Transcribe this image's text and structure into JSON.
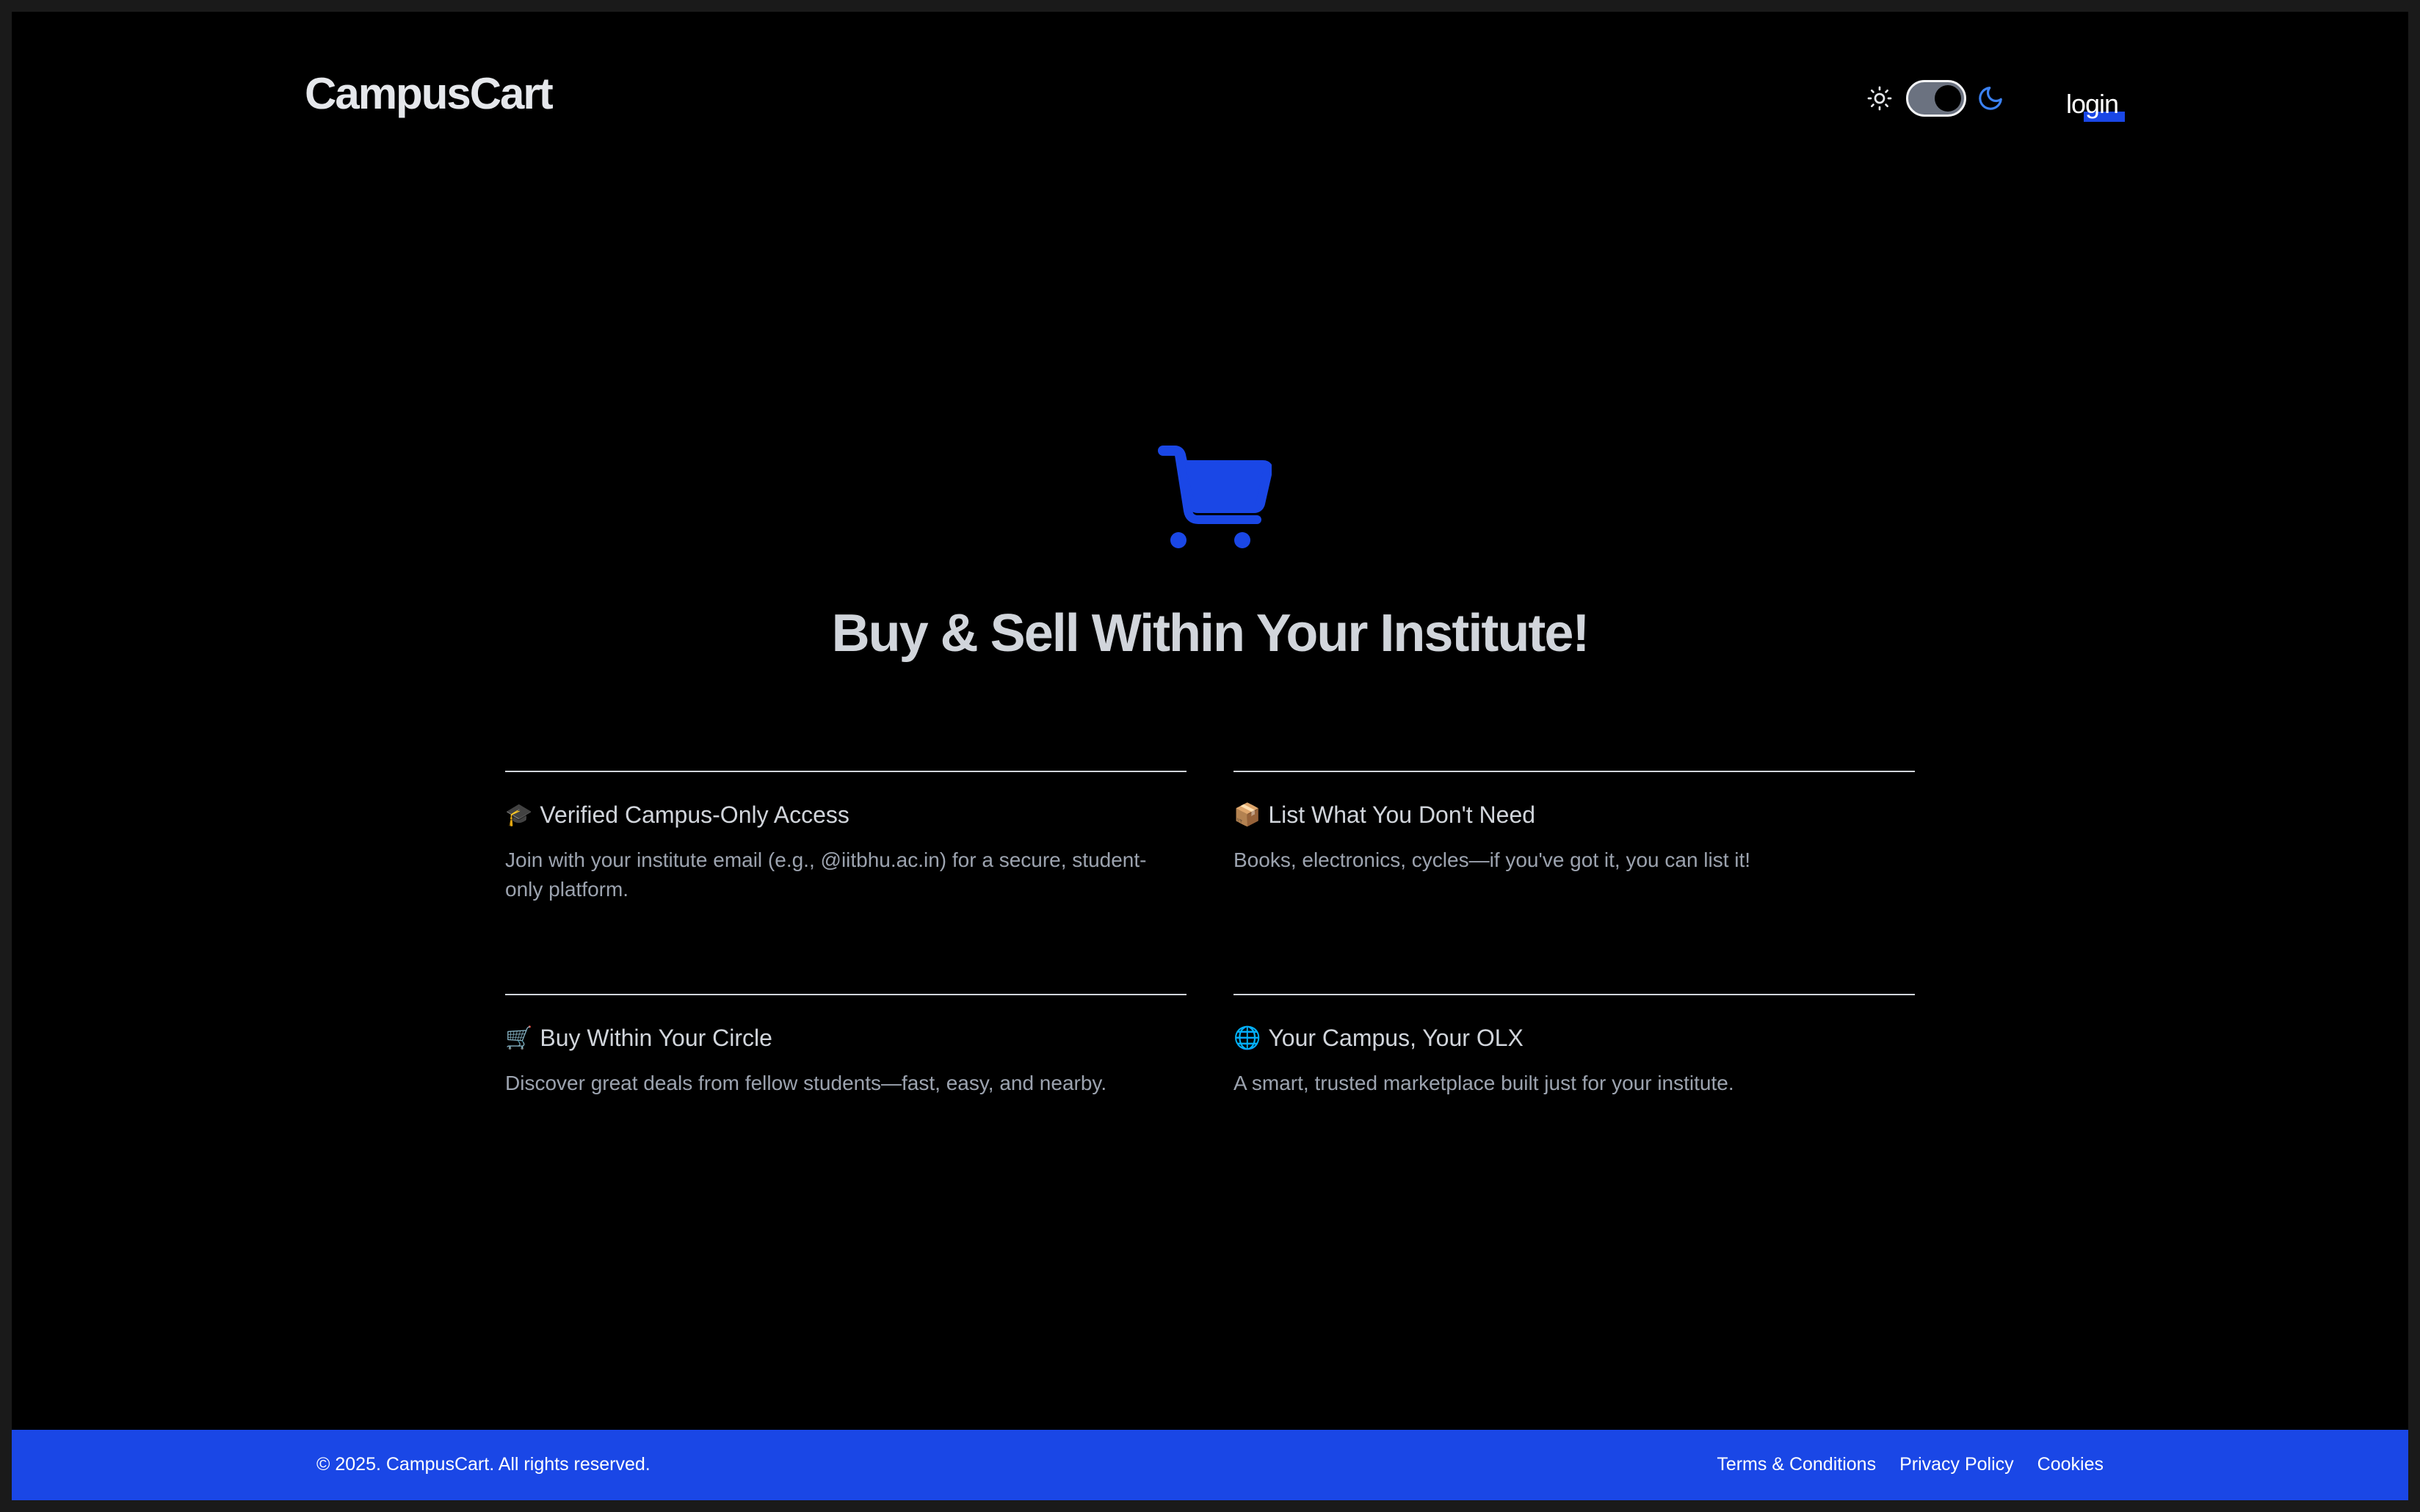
{
  "header": {
    "logo": "CampusCart",
    "theme_toggle": {
      "light_icon": "sun-icon",
      "dark_icon": "moon-icon",
      "mode": "dark"
    },
    "login_label": "login"
  },
  "hero": {
    "icon": "shopping-cart-icon",
    "title": "Buy & Sell Within Your Institute!"
  },
  "features": [
    {
      "emoji": "🎓",
      "title": "Verified Campus-Only Access",
      "description": "Join with your institute email (e.g., @iitbhu.ac.in) for a secure, student-only platform."
    },
    {
      "emoji": "📦",
      "title": "List What You Don't Need",
      "description": "Books, electronics, cycles—if you've got it, you can list it!"
    },
    {
      "emoji": "🛒",
      "title": "Buy Within Your Circle",
      "description": "Discover great deals from fellow students—fast, easy, and nearby."
    },
    {
      "emoji": "🌐",
      "title": "Your Campus, Your OLX",
      "description": "A smart, trusted marketplace built just for your institute."
    }
  ],
  "footer": {
    "copyright": "© 2025. CampusCart. All rights reserved.",
    "links": [
      "Terms & Conditions",
      "Privacy Policy",
      "Cookies"
    ]
  },
  "colors": {
    "background": "#000000",
    "accent": "#1a47e6",
    "text_primary": "#d1d5db",
    "text_secondary": "#9ca3af"
  }
}
